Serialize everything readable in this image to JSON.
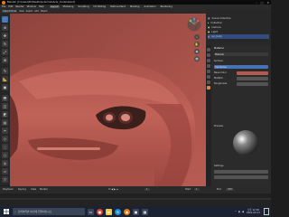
{
  "titlebar": {
    "title": "Blender [C:\\Users\\PC\\Desktop\\carmodel\\car_model.blend]"
  },
  "menubar": {
    "menus": [
      "File",
      "Edit",
      "Render",
      "Window",
      "Help"
    ],
    "tabs": [
      "Layout",
      "Modeling",
      "Sculpting",
      "UV Editing",
      "Texture Paint",
      "Shading",
      "Animation",
      "Rendering"
    ],
    "active_tab": "Layout"
  },
  "viewport_header": {
    "mode": "Object Mode",
    "items": [
      "View",
      "Select",
      "Add",
      "Object"
    ]
  },
  "outliner": {
    "rows": [
      {
        "label": "Scene Collection",
        "selected": false
      },
      {
        "label": "Collection",
        "selected": false
      },
      {
        "label": "Camera",
        "selected": false
      },
      {
        "label": "Light",
        "selected": false
      },
      {
        "label": "car_body",
        "selected": true
      }
    ]
  },
  "properties": {
    "header": "Material",
    "items": [
      "Material",
      "Surface",
      "Use Nodes",
      "Base Color",
      "Metallic",
      "Roughness"
    ],
    "preview_section": "Preview",
    "settings_section": "Settings"
  },
  "timeline": {
    "controls": [
      "Playback",
      "Keying",
      "View",
      "Marker"
    ],
    "start_label": "Start",
    "start": "1",
    "end_label": "End",
    "end": "250",
    "current_frame": "1"
  },
  "taskbar": {
    "search_placeholder": "검색하려면 여기에 입력하십시오",
    "time": "오후 12:30",
    "date": "2021-03-17"
  },
  "colors": {
    "car_body": "#b55a50",
    "viewport_bg": "#3d3d3d",
    "selection": "#334d80",
    "accent": "#4772b3"
  }
}
